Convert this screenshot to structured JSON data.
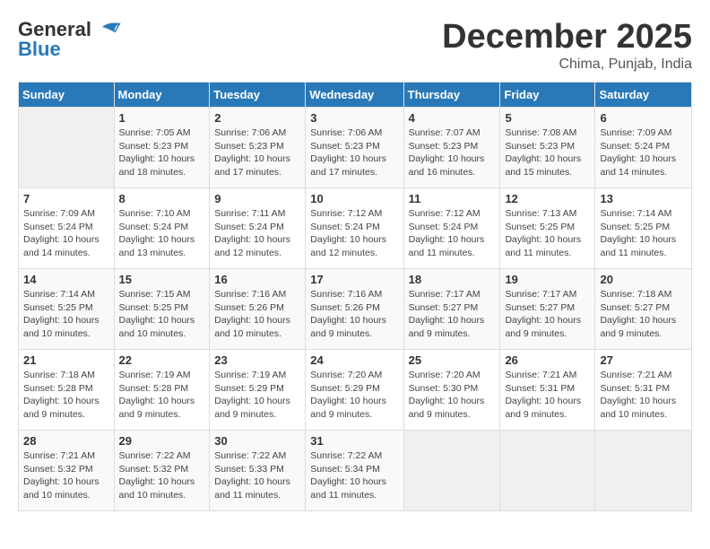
{
  "header": {
    "logo_line1": "General",
    "logo_line2": "Blue",
    "month": "December 2025",
    "location": "Chima, Punjab, India"
  },
  "columns": [
    "Sunday",
    "Monday",
    "Tuesday",
    "Wednesday",
    "Thursday",
    "Friday",
    "Saturday"
  ],
  "weeks": [
    [
      {
        "day": "",
        "info": ""
      },
      {
        "day": "1",
        "info": "Sunrise: 7:05 AM\nSunset: 5:23 PM\nDaylight: 10 hours\nand 18 minutes."
      },
      {
        "day": "2",
        "info": "Sunrise: 7:06 AM\nSunset: 5:23 PM\nDaylight: 10 hours\nand 17 minutes."
      },
      {
        "day": "3",
        "info": "Sunrise: 7:06 AM\nSunset: 5:23 PM\nDaylight: 10 hours\nand 17 minutes."
      },
      {
        "day": "4",
        "info": "Sunrise: 7:07 AM\nSunset: 5:23 PM\nDaylight: 10 hours\nand 16 minutes."
      },
      {
        "day": "5",
        "info": "Sunrise: 7:08 AM\nSunset: 5:23 PM\nDaylight: 10 hours\nand 15 minutes."
      },
      {
        "day": "6",
        "info": "Sunrise: 7:09 AM\nSunset: 5:24 PM\nDaylight: 10 hours\nand 14 minutes."
      }
    ],
    [
      {
        "day": "7",
        "info": "Sunrise: 7:09 AM\nSunset: 5:24 PM\nDaylight: 10 hours\nand 14 minutes."
      },
      {
        "day": "8",
        "info": "Sunrise: 7:10 AM\nSunset: 5:24 PM\nDaylight: 10 hours\nand 13 minutes."
      },
      {
        "day": "9",
        "info": "Sunrise: 7:11 AM\nSunset: 5:24 PM\nDaylight: 10 hours\nand 12 minutes."
      },
      {
        "day": "10",
        "info": "Sunrise: 7:12 AM\nSunset: 5:24 PM\nDaylight: 10 hours\nand 12 minutes."
      },
      {
        "day": "11",
        "info": "Sunrise: 7:12 AM\nSunset: 5:24 PM\nDaylight: 10 hours\nand 11 minutes."
      },
      {
        "day": "12",
        "info": "Sunrise: 7:13 AM\nSunset: 5:25 PM\nDaylight: 10 hours\nand 11 minutes."
      },
      {
        "day": "13",
        "info": "Sunrise: 7:14 AM\nSunset: 5:25 PM\nDaylight: 10 hours\nand 11 minutes."
      }
    ],
    [
      {
        "day": "14",
        "info": "Sunrise: 7:14 AM\nSunset: 5:25 PM\nDaylight: 10 hours\nand 10 minutes."
      },
      {
        "day": "15",
        "info": "Sunrise: 7:15 AM\nSunset: 5:25 PM\nDaylight: 10 hours\nand 10 minutes."
      },
      {
        "day": "16",
        "info": "Sunrise: 7:16 AM\nSunset: 5:26 PM\nDaylight: 10 hours\nand 10 minutes."
      },
      {
        "day": "17",
        "info": "Sunrise: 7:16 AM\nSunset: 5:26 PM\nDaylight: 10 hours\nand 9 minutes."
      },
      {
        "day": "18",
        "info": "Sunrise: 7:17 AM\nSunset: 5:27 PM\nDaylight: 10 hours\nand 9 minutes."
      },
      {
        "day": "19",
        "info": "Sunrise: 7:17 AM\nSunset: 5:27 PM\nDaylight: 10 hours\nand 9 minutes."
      },
      {
        "day": "20",
        "info": "Sunrise: 7:18 AM\nSunset: 5:27 PM\nDaylight: 10 hours\nand 9 minutes."
      }
    ],
    [
      {
        "day": "21",
        "info": "Sunrise: 7:18 AM\nSunset: 5:28 PM\nDaylight: 10 hours\nand 9 minutes."
      },
      {
        "day": "22",
        "info": "Sunrise: 7:19 AM\nSunset: 5:28 PM\nDaylight: 10 hours\nand 9 minutes."
      },
      {
        "day": "23",
        "info": "Sunrise: 7:19 AM\nSunset: 5:29 PM\nDaylight: 10 hours\nand 9 minutes."
      },
      {
        "day": "24",
        "info": "Sunrise: 7:20 AM\nSunset: 5:29 PM\nDaylight: 10 hours\nand 9 minutes."
      },
      {
        "day": "25",
        "info": "Sunrise: 7:20 AM\nSunset: 5:30 PM\nDaylight: 10 hours\nand 9 minutes."
      },
      {
        "day": "26",
        "info": "Sunrise: 7:21 AM\nSunset: 5:31 PM\nDaylight: 10 hours\nand 9 minutes."
      },
      {
        "day": "27",
        "info": "Sunrise: 7:21 AM\nSunset: 5:31 PM\nDaylight: 10 hours\nand 10 minutes."
      }
    ],
    [
      {
        "day": "28",
        "info": "Sunrise: 7:21 AM\nSunset: 5:32 PM\nDaylight: 10 hours\nand 10 minutes."
      },
      {
        "day": "29",
        "info": "Sunrise: 7:22 AM\nSunset: 5:32 PM\nDaylight: 10 hours\nand 10 minutes."
      },
      {
        "day": "30",
        "info": "Sunrise: 7:22 AM\nSunset: 5:33 PM\nDaylight: 10 hours\nand 11 minutes."
      },
      {
        "day": "31",
        "info": "Sunrise: 7:22 AM\nSunset: 5:34 PM\nDaylight: 10 hours\nand 11 minutes."
      },
      {
        "day": "",
        "info": ""
      },
      {
        "day": "",
        "info": ""
      },
      {
        "day": "",
        "info": ""
      }
    ]
  ]
}
